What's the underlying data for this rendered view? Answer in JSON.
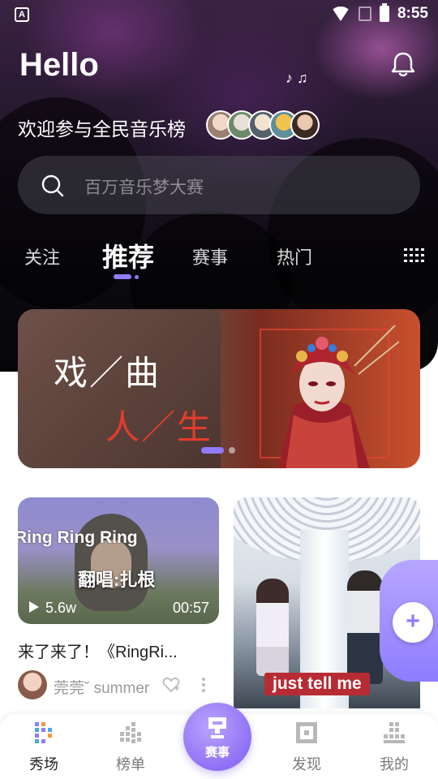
{
  "status_bar": {
    "app_badge": "A",
    "time": "8:55"
  },
  "header": {
    "greeting": "Hello",
    "welcome_text": "欢迎参与全民音乐榜",
    "notes": "♪ ♫"
  },
  "search": {
    "placeholder": "百万音乐梦大赛"
  },
  "tabs": [
    {
      "label": "关注"
    },
    {
      "label": "推荐"
    },
    {
      "label": "赛事"
    },
    {
      "label": "热门"
    }
  ],
  "banner": {
    "line1": "戏／曲",
    "line2": "人／生",
    "page_count": 2,
    "current_page": 1
  },
  "feed": {
    "card1": {
      "overlay_text": "Ring Ring Ring",
      "cover_text": "翻唱:扎根",
      "views": "5.6w",
      "duration": "00:57",
      "title": "来了来了！《RingRi...",
      "user": "莞莞˘  summer"
    },
    "card2": {
      "overlay_text": "just tell me"
    },
    "fab_icon": "+"
  },
  "bottom_nav": {
    "items": [
      {
        "label": "秀场"
      },
      {
        "label": "榜单"
      },
      {
        "label": "赛事"
      },
      {
        "label": "发现"
      },
      {
        "label": "我的"
      }
    ]
  },
  "colors": {
    "accent": "#8f7cff",
    "accent_dark": "#7d5cf0",
    "banner_red": "#e33c2c",
    "tag_red": "#b72c34"
  },
  "icons": {
    "bell": "bell-icon",
    "search": "search-icon",
    "grid": "grid-menu-icon",
    "play": "play-icon",
    "heart": "heart-icon",
    "more": "more-icon",
    "fab": "plus-icon"
  }
}
